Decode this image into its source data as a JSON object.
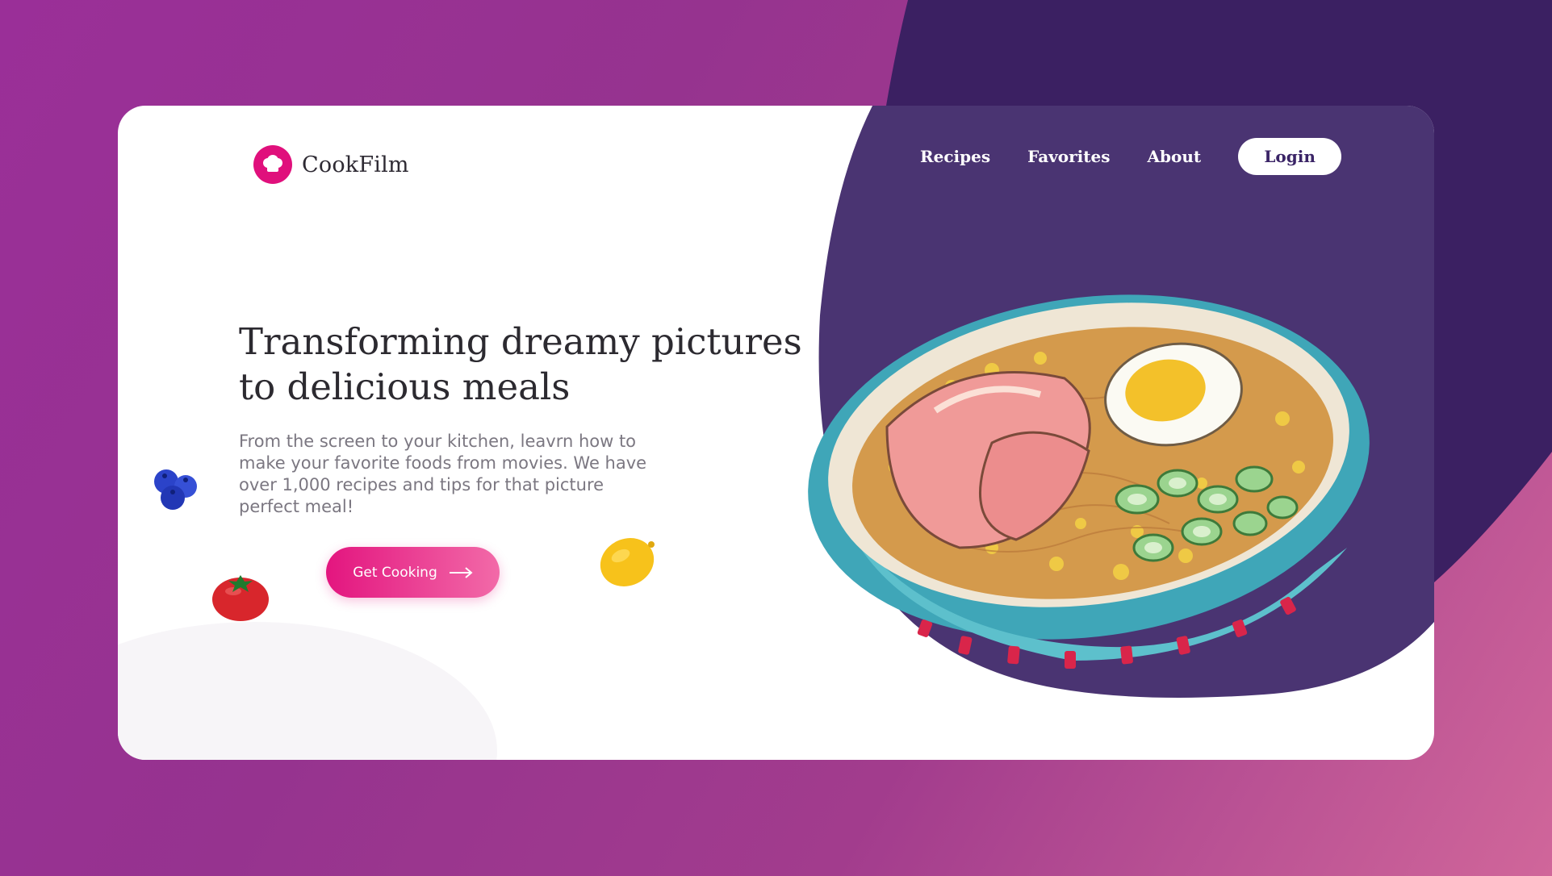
{
  "brand": {
    "name": "CookFilm",
    "logo_icon": "chef-hat-icon",
    "accent": "#e0107c"
  },
  "nav": {
    "links": [
      "Recipes",
      "Favorites",
      "About"
    ],
    "login_label": "Login"
  },
  "hero": {
    "headline_line1": "Transforming dreamy pictures",
    "headline_line2": "to delicious meals",
    "subtext": "From the screen to your kitchen, leavrn how to make your favorite foods from movies. We have over 1,000 recipes and tips for that picture perfect meal!",
    "cta_label": "Get Cooking",
    "cta_icon": "arrow-right-icon"
  },
  "decorations": [
    "blueberries-icon",
    "tomato-icon",
    "lemon-icon",
    "ramen-bowl-illustration"
  ],
  "colors": {
    "background_purple": "#9a2f98",
    "dark_purple": "#3a2466",
    "panel_purple": "#4a3472",
    "cta_pink": "#e3157f"
  }
}
